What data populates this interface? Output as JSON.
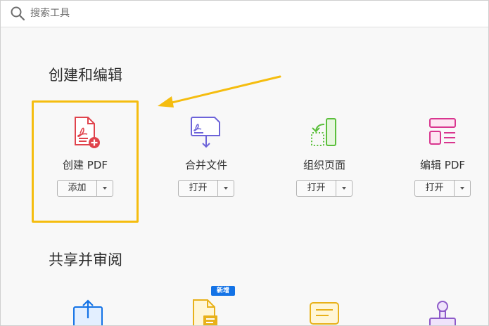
{
  "search": {
    "placeholder": "搜索工具",
    "icon": "search-icon"
  },
  "sections": {
    "create_edit": {
      "title": "创建和编辑"
    },
    "share_review": {
      "title": "共享并审阅"
    }
  },
  "tools": [
    {
      "label": "创建 PDF",
      "button": "添加",
      "icon": "create-pdf-icon",
      "color": "#e0434c"
    },
    {
      "label": "合并文件",
      "button": "打开",
      "icon": "combine-files-icon",
      "color": "#6c63d9"
    },
    {
      "label": "组织页面",
      "button": "打开",
      "icon": "organize-pages-icon",
      "color": "#5bbf3c"
    },
    {
      "label": "编辑 PDF",
      "button": "打开",
      "icon": "edit-pdf-icon",
      "color": "#d9368f"
    }
  ],
  "share_tools": [
    {
      "icon": "share-icon",
      "color": "#1473e6"
    },
    {
      "icon": "send-for-comments-icon",
      "color": "#e8b11a",
      "badge": "新增"
    },
    {
      "icon": "comment-icon",
      "color": "#e8b11a"
    },
    {
      "icon": "stamp-icon",
      "color": "#8e5bc9"
    }
  ],
  "colors": {
    "highlight": "#f5bd0f",
    "arrow": "#f5bd0f"
  }
}
